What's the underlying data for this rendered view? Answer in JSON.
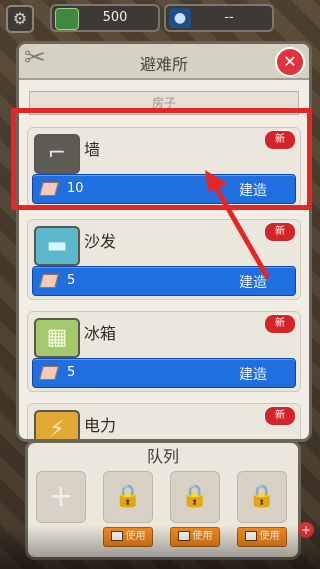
{
  "hud": {
    "settings_icon": "gear-icon",
    "cash_value": "500",
    "user_value": "--"
  },
  "dialog": {
    "title": "避难所",
    "tab_label": "房子",
    "items": [
      {
        "name": "墙",
        "cost": "10",
        "build_label": "建造",
        "new_label": "新",
        "icon": "wall-icon"
      },
      {
        "name": "沙发",
        "cost": "5",
        "build_label": "建造",
        "new_label": "新",
        "icon": "sofa-icon"
      },
      {
        "name": "冰箱",
        "cost": "5",
        "build_label": "建造",
        "new_label": "新",
        "icon": "fridge-icon"
      },
      {
        "name": "电力",
        "cost": "",
        "build_label": "",
        "new_label": "新",
        "icon": "power-icon"
      }
    ]
  },
  "queue": {
    "title": "队列",
    "use_label": "使用"
  },
  "colors": {
    "highlight": "#e62626",
    "build_bar": "#1f6fe0",
    "close_button": "#e2333a",
    "use_button": "#f58a1f"
  }
}
